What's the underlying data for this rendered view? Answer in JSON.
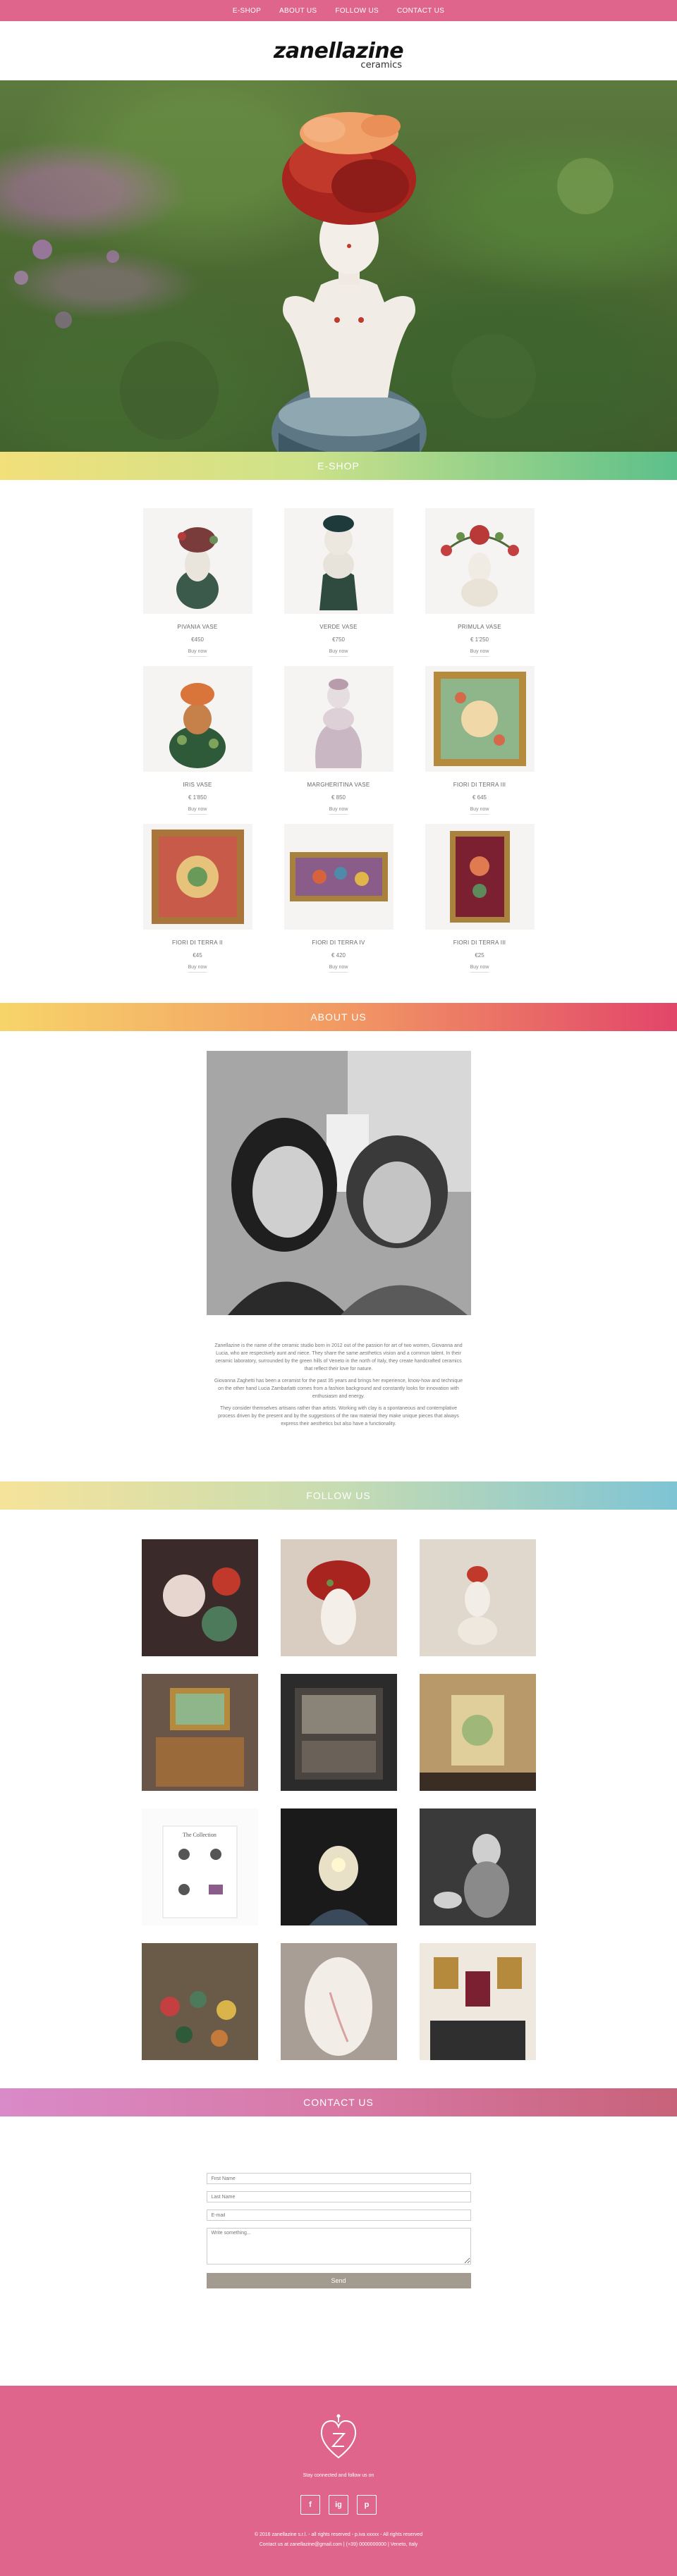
{
  "nav": {
    "items": [
      {
        "label": "E-SHOP"
      },
      {
        "label": "ABOUT US"
      },
      {
        "label": "FOLLOW US"
      },
      {
        "label": "CONTACT US"
      }
    ]
  },
  "logo": {
    "name": "zanellazine",
    "sub": "ceramics"
  },
  "sections": {
    "eshop": "E-SHOP",
    "about": "ABOUT US",
    "follow": "FOLLOW US",
    "contact": "CONTACT US"
  },
  "products": [
    {
      "name": "PIVANIA VASE",
      "price": "€450",
      "buy": "Buy now"
    },
    {
      "name": "VERDE VASE",
      "price": "€750",
      "buy": "Buy now"
    },
    {
      "name": "PRIMULA VASE",
      "price": "€ 1'250",
      "buy": "Buy now"
    },
    {
      "name": "IRIS VASE",
      "price": "€ 1'850",
      "buy": "Buy now"
    },
    {
      "name": "MARGHERITINA VASE",
      "price": "€ 850",
      "buy": "Buy now"
    },
    {
      "name": "FIORI DI TERRA III",
      "price": "€ 645",
      "buy": "Buy now"
    },
    {
      "name": "FIORI DI TERRA II",
      "price": "€45",
      "buy": "Buy now"
    },
    {
      "name": "FIORI DI TERRA IV",
      "price": "€ 420",
      "buy": "Buy now"
    },
    {
      "name": "FIORI DI TERRA III",
      "price": "€25",
      "buy": "Buy now"
    }
  ],
  "about": {
    "p1": "Zanellazine is the name of the ceramic studio born in 2012 out of the passion for art of two women, Giovanna and Lucia, who are respectively aunt and niece. They share the same aesthetics vision and a common talent. In their ceramic laboratory, surrounded by the green hills of Veneto in the north of Italy, they create handcrafted ceramics that reflect their love for nature.",
    "p2": "Giovanna Zaghetti has been a ceramist for the past 35 years and brings her experience, know-how and technique on the other hand Lucia Zambarlatti comes from a fashion background and constantly looks for innovation with enthusiasm and energy.",
    "p3": "They consider themselves artisans rather than artists. Working with clay is a spontaneous and contemplative process driven by the present and by the suggestions of the raw material they make unique pieces that always express their aesthetics but also have a functionality."
  },
  "contact": {
    "first_name": "First Name",
    "last_name": "Last Name",
    "email": "E-mail",
    "message": "Write something...",
    "send": "Send"
  },
  "footer": {
    "tagline": "Stay connected and follow us on",
    "copy1": "© 2016 zanellazine s.r.l. - all rights reserved - p.iva xxxxx - All rights reserved",
    "copy2": "Contact us at zanellazine@gmail.com | (+39) 0000000000 | Veneto, Italy",
    "social": [
      "f",
      "ig",
      "p"
    ]
  },
  "colors": {
    "pink": "#e0658d",
    "send": "#a49b90"
  }
}
